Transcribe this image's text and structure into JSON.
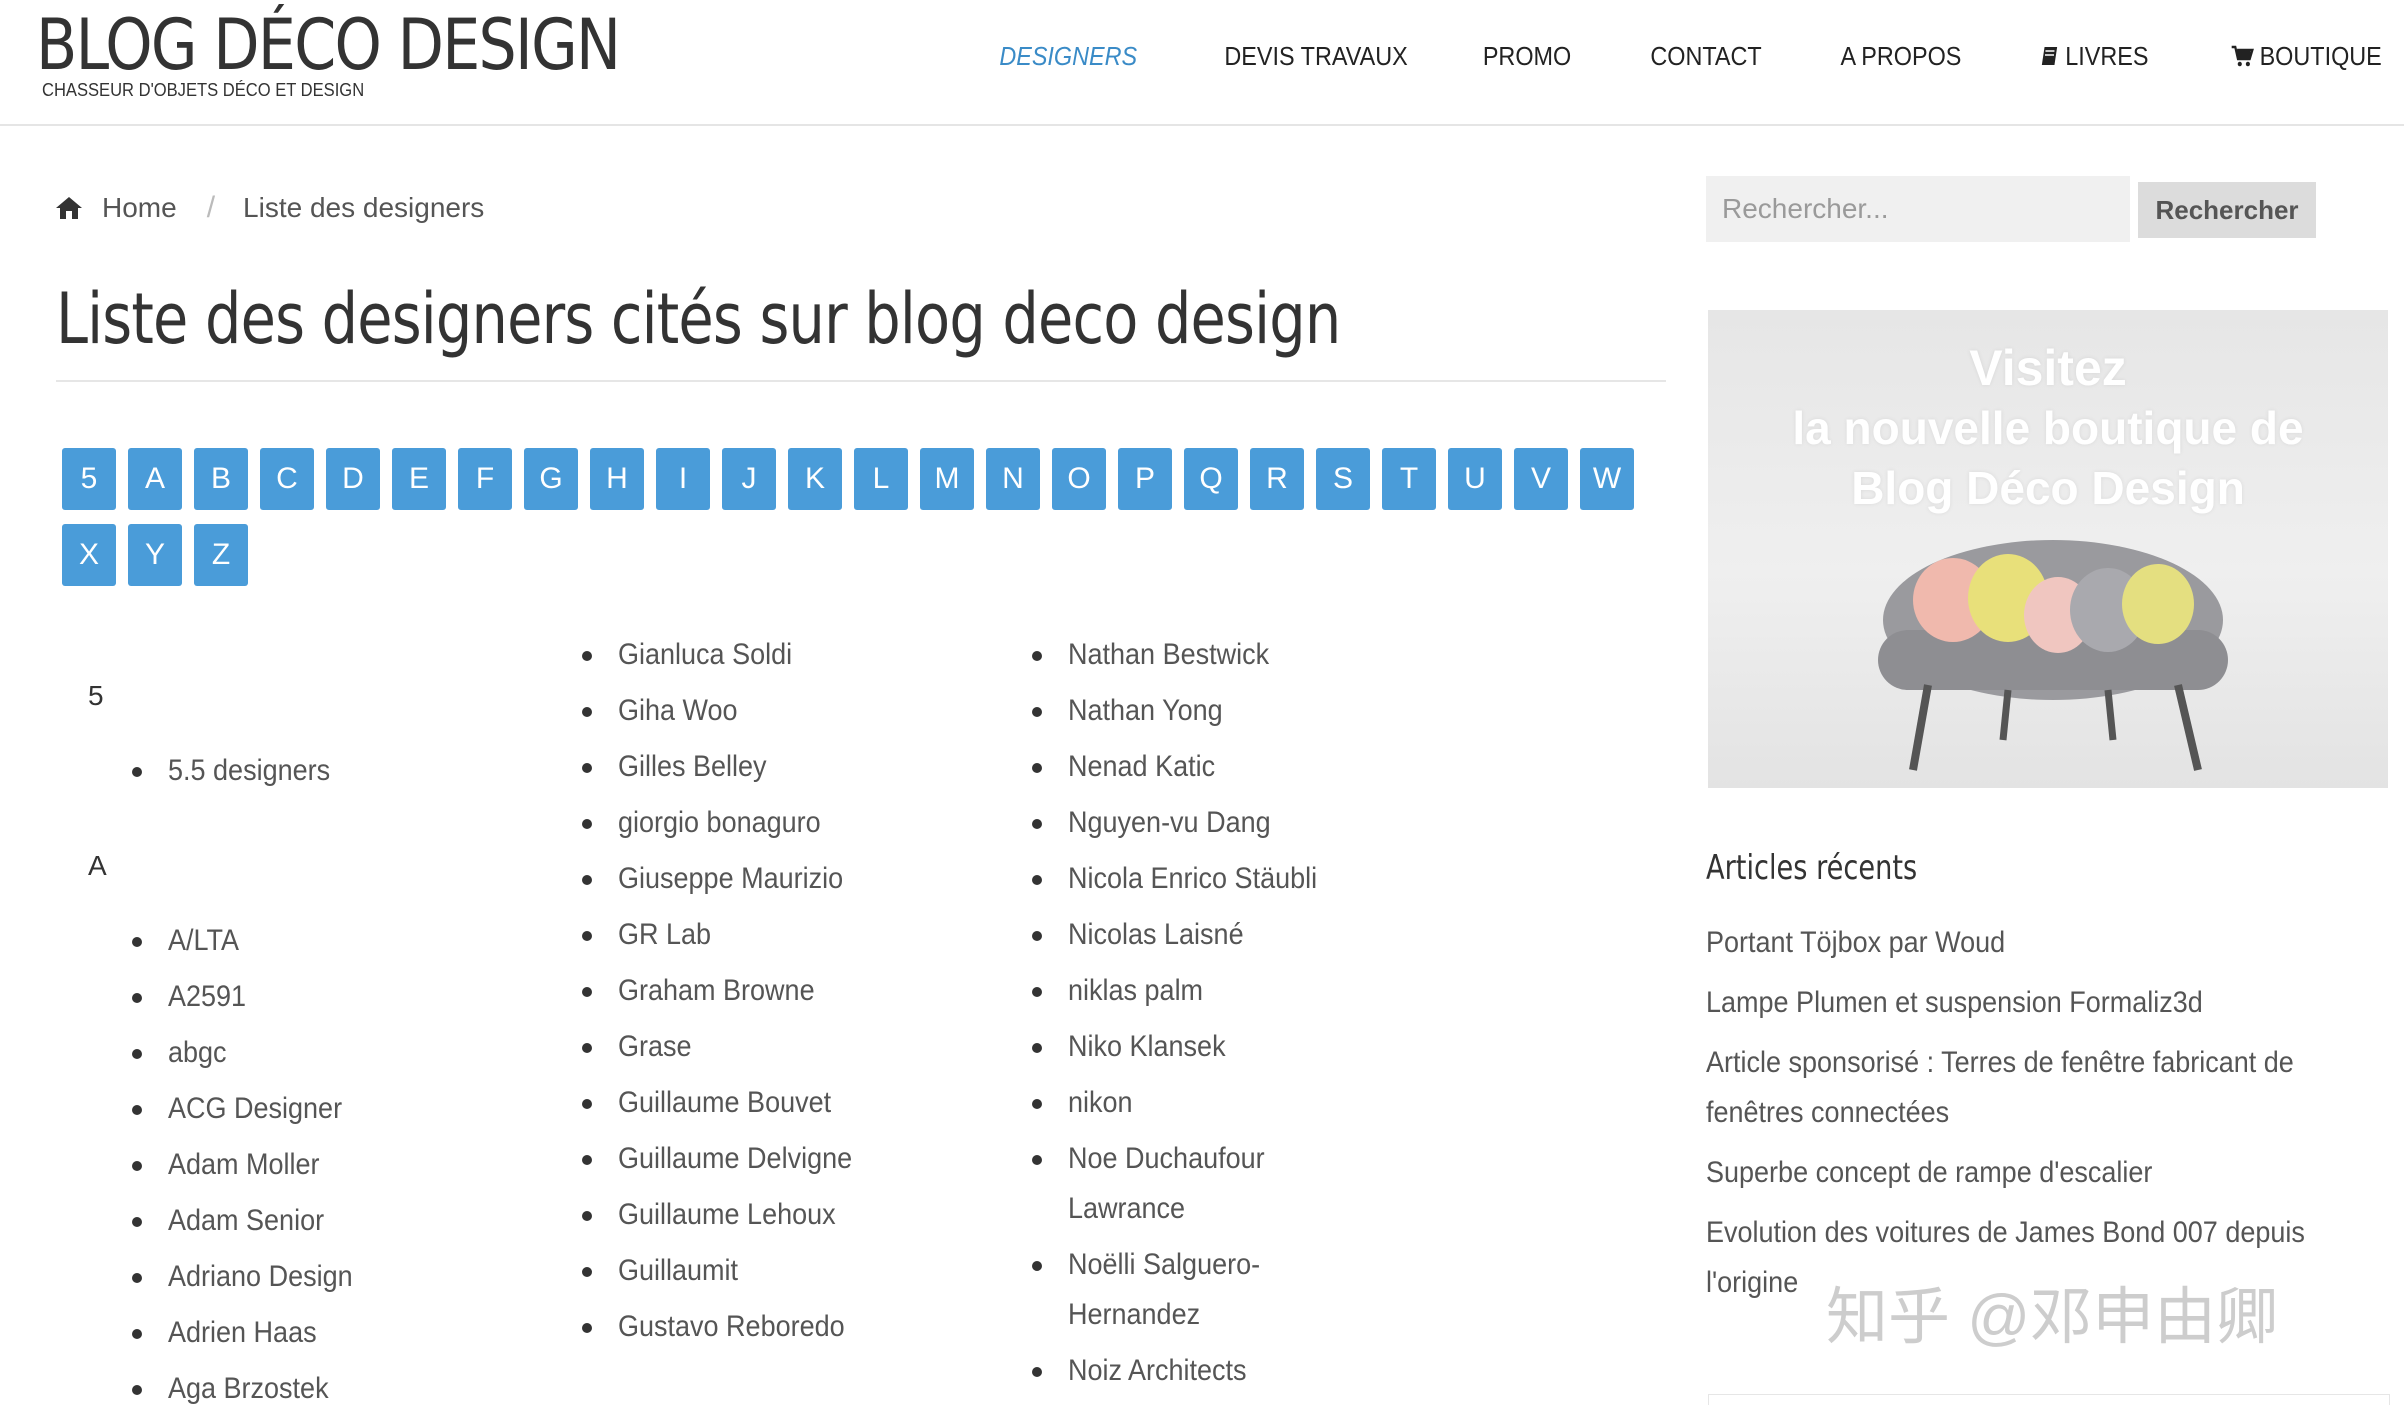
{
  "site": {
    "title": "BLOG DÉCO DESIGN",
    "tagline": "CHASSEUR D'OBJETS DÉCO ET DESIGN"
  },
  "nav": {
    "designers": "DESIGNERS",
    "devis": "DEVIS TRAVAUX",
    "promo": "PROMO",
    "contact": "CONTACT",
    "apropos": "A PROPOS",
    "livres": "LIVRES",
    "boutique": "BOUTIQUE",
    "active_color": "#3a8bc7"
  },
  "breadcrumb": {
    "home": "Home",
    "separator": "/",
    "current": "Liste des designers"
  },
  "page": {
    "title": "Liste des designers cités sur blog deco design"
  },
  "letters": [
    "5",
    "A",
    "B",
    "C",
    "D",
    "E",
    "F",
    "G",
    "H",
    "I",
    "J",
    "K",
    "L",
    "M",
    "N",
    "O",
    "P",
    "Q",
    "R",
    "S",
    "T",
    "U",
    "V",
    "W",
    "X",
    "Y",
    "Z"
  ],
  "columns": {
    "col1": {
      "section5": "5",
      "items5": [
        "5.5 designers"
      ],
      "sectionA": "A",
      "itemsA": [
        "A/LTA",
        "A2591",
        "abgc",
        "ACG Designer",
        "Adam Moller",
        "Adam Senior",
        "Adriano Design",
        "Adrien Haas",
        "Aga Brzostek"
      ]
    },
    "col2": [
      "Gianluca Soldi",
      "Giha Woo",
      "Gilles Belley",
      "giorgio bonaguro",
      "Giuseppe Maurizio",
      "GR Lab",
      "Graham Browne",
      "Grase",
      "Guillaume Bouvet",
      "Guillaume Delvigne",
      "Guillaume Lehoux",
      "Guillaumit",
      "Gustavo Reboredo"
    ],
    "col3": [
      "Nathan Bestwick",
      "Nathan Yong",
      "Nenad Katic",
      "Nguyen-vu Dang",
      "Nicola Enrico Stäubli",
      "Nicolas Laisné",
      "niklas palm",
      "Niko Klansek",
      "nikon",
      "Noe Duchaufour Lawrance",
      "Noëlli Salguero-Hernandez",
      "Noiz Architects"
    ]
  },
  "search": {
    "placeholder": "Rechercher...",
    "button": "Rechercher"
  },
  "promo": {
    "line1": "Visitez",
    "line2": "la nouvelle boutique de",
    "line3": "Blog Déco Design"
  },
  "sidebar": {
    "heading": "Articles récents",
    "articles": [
      "Portant Töjbox par Woud",
      "Lampe Plumen et suspension Formaliz3d",
      "Article sponsorisé : Terres de fenêtre fabricant de fenêtres connectées",
      "Superbe concept de rampe d'escalier",
      "Evolution des voitures de James Bond 007 depuis l'origine"
    ]
  },
  "watermark": "知乎 @邓申由卿",
  "colors": {
    "letter_bg": "#4a9cd9",
    "text": "#555555"
  }
}
